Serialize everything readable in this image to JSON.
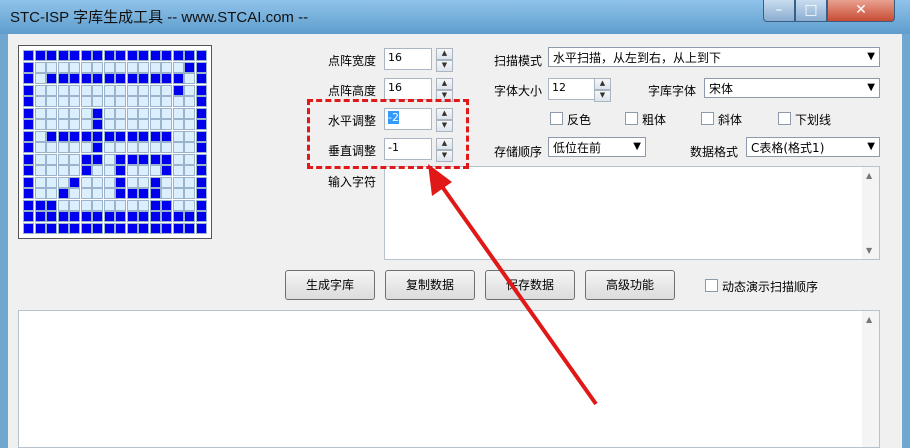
{
  "window": {
    "title": "STC-ISP 字库生成工具 -- www.STCAI.com --",
    "min_glyph": "–",
    "max_glyph": "□",
    "close_glyph": "✕"
  },
  "fields": {
    "dot_width": {
      "label": "点阵宽度",
      "value": "16"
    },
    "dot_height": {
      "label": "点阵高度",
      "value": "16"
    },
    "h_adjust": {
      "label": "水平调整",
      "value": "-2"
    },
    "v_adjust": {
      "label": "垂直调整",
      "value": "-1"
    },
    "font_size": {
      "label": "字体大小",
      "value": "12"
    },
    "input_chars": {
      "label": "输入字符",
      "value": ""
    }
  },
  "combos": {
    "scan_mode": {
      "label": "扫描模式",
      "value": "水平扫描，从左到右，从上到下"
    },
    "font_face": {
      "label": "字库字体",
      "value": "宋体"
    },
    "byte_order": {
      "label": "存储顺序",
      "value": "低位在前"
    },
    "data_format": {
      "label": "数据格式",
      "value": "C表格(格式1)"
    }
  },
  "checkboxes": {
    "invert": "反色",
    "bold": "粗体",
    "italic": "斜体",
    "underline": "下划线",
    "animate_scan": "动态演示扫描顺序"
  },
  "buttons": {
    "generate": "生成字库",
    "copy": "复制数据",
    "save": "保存数据",
    "advanced": "高级功能"
  },
  "glyph": {
    "rows": [
      "1111111111111111",
      "1000000000000011",
      "1011111111111101",
      "1000000000000101",
      "1000000000000001",
      "1000001000000001",
      "1000001000000001",
      "1011111111111001",
      "1000001000000001",
      "1000011011111001",
      "1000010010001001",
      "1000100010010001",
      "1001000011110001",
      "1110000000011001",
      "1111111111111111",
      "1111111111111111"
    ],
    "on_color": "#0000ee",
    "off_color": "#dcefff"
  },
  "annotation": {
    "highlight_color": "#e01818",
    "arrow_color": "#e01818"
  }
}
